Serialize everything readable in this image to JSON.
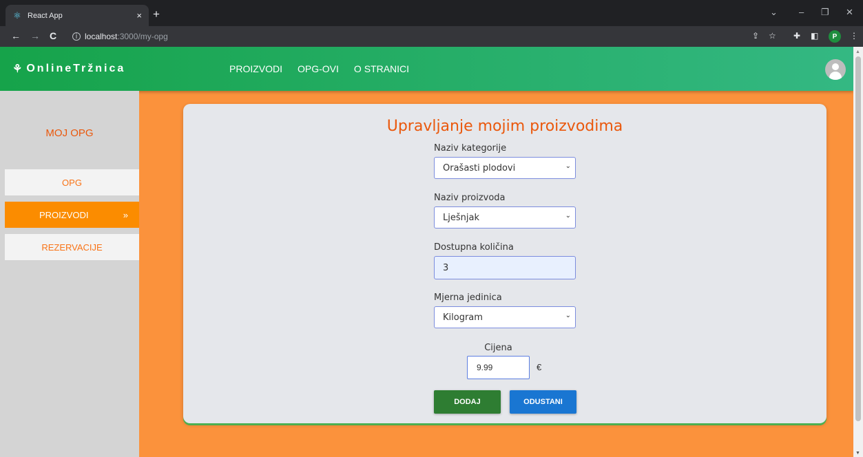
{
  "browser": {
    "tab_title": "React App",
    "tab_close": "×",
    "new_tab": "+",
    "url_host": "localhost",
    "url_path": ":3000/my-opg",
    "back": "←",
    "forward": "→",
    "reload": "C",
    "profile_initial": "P",
    "win_dropdown": "⌄",
    "win_minimize": "–",
    "win_restore": "❐",
    "win_close": "✕"
  },
  "app": {
    "logo": "OnlineTržnica",
    "logo_icon": "⚘",
    "nav": [
      "PROIZVODI",
      "OPG-OVI",
      "O STRANICI"
    ]
  },
  "sidebar": {
    "title": "MOJ OPG",
    "items": [
      {
        "label": "OPG",
        "active": false
      },
      {
        "label": "PROIZVODI",
        "active": true
      },
      {
        "label": "REZERVACIJE",
        "active": false
      }
    ],
    "active_arrow": "»"
  },
  "form": {
    "title": "Upravljanje mojim proizvodima",
    "category": {
      "label": "Naziv kategorije",
      "value": "Orašasti plodovi"
    },
    "product": {
      "label": "Naziv proizvoda",
      "value": "Lješnjak"
    },
    "quantity": {
      "label": "Dostupna količina",
      "value": "3"
    },
    "unit": {
      "label": "Mjerna jedinica",
      "value": "Kilogram"
    },
    "price": {
      "label": "Cijena",
      "value": "9.99",
      "currency": "€"
    },
    "add_label": "DODAJ",
    "cancel_label": "ODUSTANI"
  },
  "colors": {
    "accent_orange": "#fb923c",
    "header_green": "#16a34a",
    "add_button": "#2e7d32",
    "cancel_button": "#1976d2"
  }
}
